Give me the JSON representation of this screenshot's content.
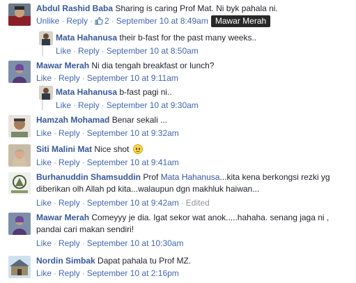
{
  "comments": [
    {
      "author": "Abdul Rashid Baba",
      "text": "Sharing is caring Prof Mat. Ni byk pahala ni.",
      "unlike": "Unlike",
      "reply": "Reply",
      "like_count": "2",
      "time": "September 10 at 8:49am",
      "tooltip": "Mawar Merah"
    },
    {
      "author": "Mata Hahanusa",
      "text": "their b-fast for the past many weeks..",
      "like": "Like",
      "reply": "Reply",
      "time": "September 10 at 8:50am"
    },
    {
      "author": "Mawar Merah",
      "text": "Ni dia tengah breakfast or lunch?",
      "like": "Like",
      "reply": "Reply",
      "time": "September 10 at 9:11am"
    },
    {
      "author": "Mata Hahanusa",
      "text": "b-fast pagi ni..",
      "like": "Like",
      "reply": "Reply",
      "time": "September 10 at 9:30am"
    },
    {
      "author": "Hamzah Mohamad",
      "text": "Benar sekali ...",
      "like": "Like",
      "reply": "Reply",
      "time": "September 10 at 9:32am"
    },
    {
      "author": "Siti Malini Mat",
      "text": "Nice shot",
      "like": "Like",
      "reply": "Reply",
      "time": "September 10 at 9:41am"
    },
    {
      "author": "Burhanuddin Shamsuddin",
      "text_pre": "Prof",
      "mention": "Mata Hahanusa",
      "text_post": "...kita kena berkongsi rezki yg",
      "text_line2": "diberikan olh Allah pd kita...walaupun dgn makhluk haiwan...",
      "like": "Like",
      "reply": "Reply",
      "time": "September 10 at 9:42am",
      "edited": "Edited"
    },
    {
      "author": "Mawar Merah",
      "text": "Comeyyy je dia. Igat sekor wat anok.....hahaha. senang jaga ni ,",
      "text_line2": "pandai cari makan sendiri!",
      "like": "Like",
      "reply": "Reply",
      "time": "September 10 at 10:30am"
    },
    {
      "author": "Nordin Simbak",
      "text": "Dapat pahala tu Prof MZ.",
      "like": "Like",
      "reply": "Reply",
      "time": "September 10 at 2:16pm"
    }
  ]
}
